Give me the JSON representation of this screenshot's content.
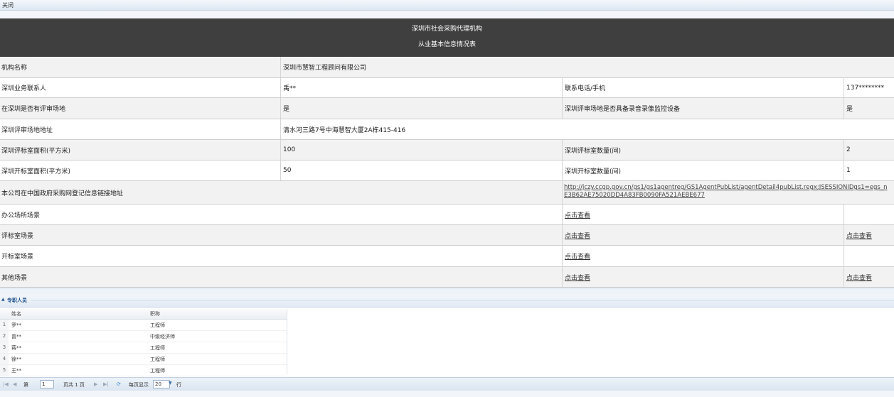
{
  "toolbar": {
    "close_label": "关闭"
  },
  "header": {
    "title1": "深圳市社会采购代理机构",
    "title2": "从业基本信息情况表"
  },
  "rows": [
    {
      "label": "机构名称",
      "value": "深圳市慧智工程顾问有限公司"
    },
    {
      "label": "深圳业务联系人",
      "value": "禹**",
      "label2": "联系电话/手机",
      "value2": "137********"
    },
    {
      "label": "在深圳是否有评审场地",
      "value": "是",
      "label2": "深圳评审场地是否具备录音录像监控设备",
      "value2": "是"
    },
    {
      "label": "深圳评审场地地址",
      "value": "清水河三路7号中海慧智大厦2A栋415-416"
    },
    {
      "label": "深圳评标室面积(平方米)",
      "value": "100",
      "label2": "深圳评标室数量(间)",
      "value2": "2"
    },
    {
      "label": "深圳开标室面积(平方米)",
      "value": "50",
      "label2": "深圳开标室数量(间)",
      "value2": "1"
    },
    {
      "label": "本公司在中国政府采购网登记信息链接地址",
      "link_line1": "http://jczy.ccgp.gov.cn/gs1/gs1agentreg/GS1AgentPubList/agentDetail4pubList.regx;JSESSIONIDgs1=egs_n",
      "link_line2": "E3B62AE75020DD4A83FB0090FA521AEBE677"
    },
    {
      "label": "办公场所场景",
      "link1": "点击查看"
    },
    {
      "label": "评标室场景",
      "link1": "点击查看",
      "link2": "点击查看"
    },
    {
      "label": "开标室场景",
      "link1": "点击查看"
    },
    {
      "label": "其他场景",
      "link1": "点击查看",
      "link2": "点击查看"
    }
  ],
  "staff_panel": {
    "title": "专职人员",
    "columns": [
      "姓名",
      "职称"
    ],
    "rows": [
      {
        "num": "1",
        "name": "罗**",
        "title": "工程师"
      },
      {
        "num": "2",
        "name": "曾**",
        "title": "中级经济师"
      },
      {
        "num": "3",
        "name": "蒋**",
        "title": "工程师"
      },
      {
        "num": "4",
        "name": "徐**",
        "title": "工程师"
      },
      {
        "num": "5",
        "name": "王**",
        "title": "工程师"
      }
    ]
  },
  "pager": {
    "page_prefix": "第",
    "page_value": "1",
    "page_total": "页共 1 页",
    "per_page_label": "每页显示",
    "per_page_value": "20",
    "per_page_suffix": "行"
  }
}
